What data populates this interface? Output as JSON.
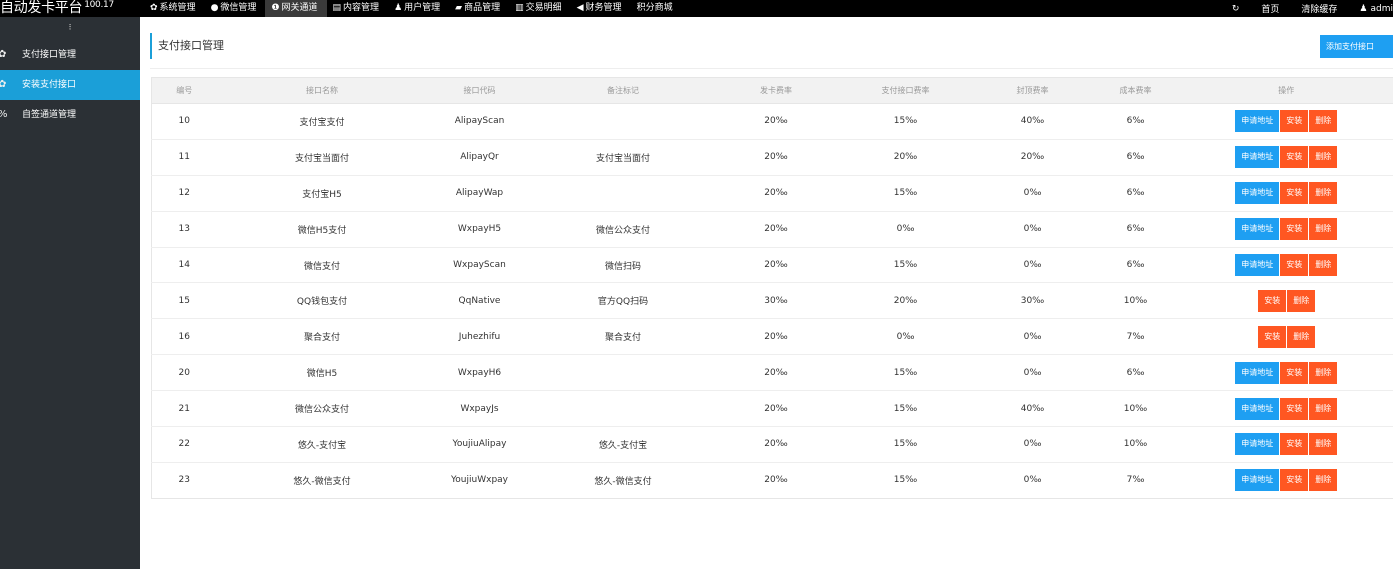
{
  "brand": {
    "title": "自动发卡平台",
    "version": "100.17"
  },
  "nav": [
    {
      "label": "系统管理",
      "icon": "gear-icon",
      "glyph": "✿",
      "active": false
    },
    {
      "label": "微信管理",
      "icon": "wechat-icon",
      "glyph": "●",
      "active": false
    },
    {
      "label": "网关通道",
      "icon": "gateway-icon",
      "glyph": "❶",
      "active": true
    },
    {
      "label": "内容管理",
      "icon": "document-icon",
      "glyph": "▤",
      "active": false
    },
    {
      "label": "用户管理",
      "icon": "users-icon",
      "glyph": "♟",
      "active": false
    },
    {
      "label": "商品管理",
      "icon": "shopping-bag-icon",
      "glyph": "▰",
      "active": false
    },
    {
      "label": "交易明细",
      "icon": "bar-chart-icon",
      "glyph": "▥",
      "active": false
    },
    {
      "label": "财务管理",
      "icon": "finance-icon",
      "glyph": "◀",
      "active": false
    },
    {
      "label": "积分商城",
      "icon": "",
      "glyph": "",
      "active": false
    }
  ],
  "topright": {
    "refresh_glyph": "↻",
    "home": "首页",
    "clear_cache": "清除缓存",
    "user_glyph": "♟",
    "user": "admi"
  },
  "sidebar": {
    "toggle": "⁝",
    "items": [
      {
        "label": "支付接口管理",
        "glyph": "✿",
        "active": false
      },
      {
        "label": "安装支付接口",
        "glyph": "✿",
        "active": true
      },
      {
        "label": "自签通道管理",
        "glyph": "%",
        "active": false
      }
    ]
  },
  "page": {
    "title": "支付接口管理",
    "add_button": "添加支付接口"
  },
  "table": {
    "headers": [
      "编号",
      "接口名称",
      "接口代码",
      "备注标记",
      "发卡费率",
      "支付接口费率",
      "封顶费率",
      "成本费率",
      "操作"
    ],
    "button_labels": {
      "apply": "申请地址",
      "install": "安装",
      "delete": "删除"
    },
    "rows": [
      {
        "id": "10",
        "name": "支付宝支付",
        "code": "AlipayScan",
        "remark": "",
        "card_rate": "20‰",
        "pay_rate": "15‰",
        "cap_rate": "40‰",
        "cost_rate": "6‰",
        "apply": true
      },
      {
        "id": "11",
        "name": "支付宝当面付",
        "code": "AlipayQr",
        "remark": "支付宝当面付",
        "card_rate": "20‰",
        "pay_rate": "20‰",
        "cap_rate": "20‰",
        "cost_rate": "6‰",
        "apply": true
      },
      {
        "id": "12",
        "name": "支付宝H5",
        "code": "AlipayWap",
        "remark": "",
        "card_rate": "20‰",
        "pay_rate": "15‰",
        "cap_rate": "0‰",
        "cost_rate": "6‰",
        "apply": true
      },
      {
        "id": "13",
        "name": "微信H5支付",
        "code": "WxpayH5",
        "remark": "微信公众支付",
        "card_rate": "20‰",
        "pay_rate": "0‰",
        "cap_rate": "0‰",
        "cost_rate": "6‰",
        "apply": true
      },
      {
        "id": "14",
        "name": "微信支付",
        "code": "WxpayScan",
        "remark": "微信扫码",
        "card_rate": "20‰",
        "pay_rate": "15‰",
        "cap_rate": "0‰",
        "cost_rate": "6‰",
        "apply": true
      },
      {
        "id": "15",
        "name": "QQ钱包支付",
        "code": "QqNative",
        "remark": "官方QQ扫码",
        "card_rate": "30‰",
        "pay_rate": "20‰",
        "cap_rate": "30‰",
        "cost_rate": "10‰",
        "apply": false
      },
      {
        "id": "16",
        "name": "聚合支付",
        "code": "Juhezhifu",
        "remark": "聚合支付",
        "card_rate": "20‰",
        "pay_rate": "0‰",
        "cap_rate": "0‰",
        "cost_rate": "7‰",
        "apply": false
      },
      {
        "id": "20",
        "name": "微信H5",
        "code": "WxpayH6",
        "remark": "",
        "card_rate": "20‰",
        "pay_rate": "15‰",
        "cap_rate": "0‰",
        "cost_rate": "6‰",
        "apply": true
      },
      {
        "id": "21",
        "name": "微信公众支付",
        "code": "WxpayJs",
        "remark": "",
        "card_rate": "20‰",
        "pay_rate": "15‰",
        "cap_rate": "40‰",
        "cost_rate": "10‰",
        "apply": true
      },
      {
        "id": "22",
        "name": "悠久-支付宝",
        "code": "YoujiuAlipay",
        "remark": "悠久-支付宝",
        "card_rate": "20‰",
        "pay_rate": "15‰",
        "cap_rate": "0‰",
        "cost_rate": "10‰",
        "apply": true
      },
      {
        "id": "23",
        "name": "悠久-微信支付",
        "code": "YoujiuWxpay",
        "remark": "悠久-微信支付",
        "card_rate": "20‰",
        "pay_rate": "15‰",
        "cap_rate": "0‰",
        "cost_rate": "7‰",
        "apply": true
      }
    ]
  },
  "colors": {
    "topbar": "#000000",
    "sidebar": "#2b3035",
    "sidebar_active": "#1b9fd8",
    "btn_blue": "#1e9ff2",
    "btn_red": "#ff5722"
  }
}
